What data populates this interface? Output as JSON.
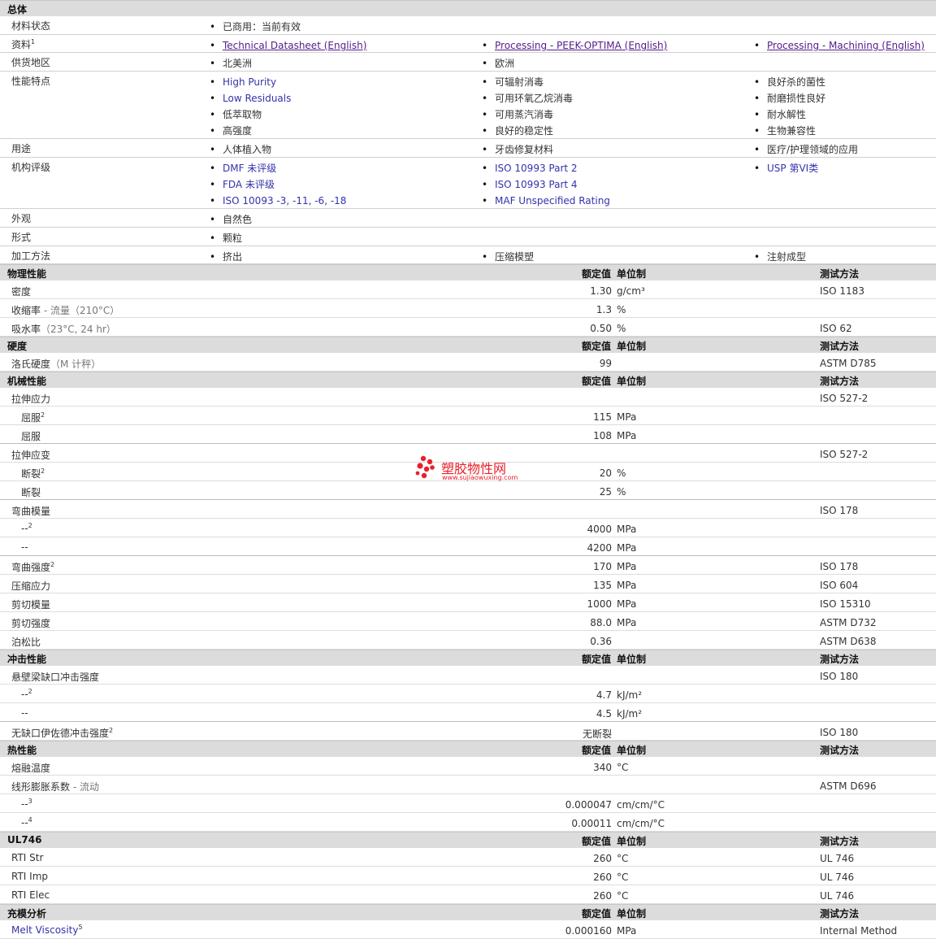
{
  "overview": {
    "title": "总体",
    "rows": [
      {
        "label": "材料状态",
        "cols": [
          [
            {
              "text": "已商用：当前有效"
            }
          ],
          [],
          []
        ]
      },
      {
        "label": "资料",
        "sup": "1",
        "cols": [
          [
            {
              "text": "Technical Datasheet (English)",
              "link": true
            }
          ],
          [
            {
              "text": "Processing - PEEK-OPTIMA (English)",
              "link": true
            }
          ],
          [
            {
              "text": "Processing - Machining (English)",
              "link": true
            }
          ]
        ]
      },
      {
        "label": "供货地区",
        "cols": [
          [
            {
              "text": "北美洲"
            }
          ],
          [
            {
              "text": "欧洲"
            }
          ],
          []
        ]
      },
      {
        "label": "性能特点",
        "cols": [
          [
            {
              "text": "High Purity",
              "blue": true
            },
            {
              "text": "Low Residuals",
              "blue": true
            },
            {
              "text": "低萃取物"
            },
            {
              "text": "高强度"
            }
          ],
          [
            {
              "text": "可辐射消毒"
            },
            {
              "text": "可用环氧乙烷消毒"
            },
            {
              "text": "可用蒸汽消毒"
            },
            {
              "text": "良好的稳定性"
            }
          ],
          [
            {
              "text": "良好杀的菌性"
            },
            {
              "text": "耐磨损性良好"
            },
            {
              "text": "耐水解性"
            },
            {
              "text": "生物兼容性"
            }
          ]
        ]
      },
      {
        "label": "用途",
        "cols": [
          [
            {
              "text": "人体植入物"
            }
          ],
          [
            {
              "text": "牙齿修复材料"
            }
          ],
          [
            {
              "text": "医疗/护理领域的应用"
            }
          ]
        ]
      },
      {
        "label": "机构评级",
        "cols": [
          [
            {
              "text": "DMF 未评级",
              "blue": true
            },
            {
              "text": "FDA 未评级",
              "blue": true
            },
            {
              "text": "ISO 10093 -3, -11, -6, -18",
              "blue": true
            }
          ],
          [
            {
              "text": "ISO 10993 Part 2",
              "blue": true
            },
            {
              "text": "ISO 10993 Part 4",
              "blue": true
            },
            {
              "text": "MAF Unspecified Rating",
              "blue": true
            }
          ],
          [
            {
              "text": "USP 第VI类",
              "blue": true
            }
          ]
        ]
      },
      {
        "label": "外观",
        "cols": [
          [
            {
              "text": "自然色"
            }
          ],
          [],
          []
        ]
      },
      {
        "label": "形式",
        "cols": [
          [
            {
              "text": "颗粒"
            }
          ],
          [],
          []
        ]
      },
      {
        "label": "加工方法",
        "cols": [
          [
            {
              "text": "挤出"
            }
          ],
          [
            {
              "text": "压缩模塑"
            }
          ],
          [
            {
              "text": "注射成型"
            }
          ]
        ]
      }
    ]
  },
  "headers": {
    "value": "额定值",
    "unit": "单位制",
    "method": "测试方法"
  },
  "sections": [
    {
      "title": "物理性能",
      "rows": [
        {
          "label": "密度",
          "value": "1.30",
          "unit": "g/cm³",
          "method": "ISO 1183"
        },
        {
          "label": "收缩率",
          "note": " - 流量（210°C）",
          "value": "1.3",
          "unit": "%",
          "method": ""
        },
        {
          "label": "吸水率",
          "note": "（23°C, 24 hr）",
          "value": "0.50",
          "unit": "%",
          "method": "ISO 62"
        }
      ]
    },
    {
      "title": "硬度",
      "rows": [
        {
          "label": "洛氏硬度",
          "note": "（M 计秤）",
          "value": "99",
          "unit": "",
          "method": "ASTM D785"
        }
      ]
    },
    {
      "title": "机械性能",
      "rows": [
        {
          "label": "拉伸应力",
          "value": "",
          "unit": "",
          "method": "ISO 527-2"
        },
        {
          "label": "屈服",
          "sub": true,
          "sup": "2",
          "value": "115",
          "unit": "MPa",
          "method": ""
        },
        {
          "label": "屈服",
          "sub": true,
          "value": "108",
          "unit": "MPa",
          "method": "",
          "end": true
        },
        {
          "label": "拉伸应变",
          "value": "",
          "unit": "",
          "method": "ISO 527-2"
        },
        {
          "label": "断裂",
          "sub": true,
          "sup": "2",
          "value": "20",
          "unit": "%",
          "method": ""
        },
        {
          "label": "断裂",
          "sub": true,
          "value": "25",
          "unit": "%",
          "method": "",
          "end": true
        },
        {
          "label": "弯曲模量",
          "value": "",
          "unit": "",
          "method": "ISO 178"
        },
        {
          "label": "--",
          "sub": true,
          "sup": "2",
          "value": "4000",
          "unit": "MPa",
          "method": ""
        },
        {
          "label": "--",
          "sub": true,
          "value": "4200",
          "unit": "MPa",
          "method": "",
          "end": true
        },
        {
          "label": "弯曲强度",
          "sup": "2",
          "value": "170",
          "unit": "MPa",
          "method": "ISO 178"
        },
        {
          "label": "压缩应力",
          "value": "135",
          "unit": "MPa",
          "method": "ISO 604"
        },
        {
          "label": "剪切模量",
          "value": "1000",
          "unit": "MPa",
          "method": "ISO 15310"
        },
        {
          "label": "剪切强度",
          "value": "88.0",
          "unit": "MPa",
          "method": "ASTM D732"
        },
        {
          "label": "泊松比",
          "value": "0.36",
          "unit": "",
          "method": "ASTM D638"
        }
      ]
    },
    {
      "title": "冲击性能",
      "rows": [
        {
          "label": "悬壁梁缺口冲击强度",
          "value": "",
          "unit": "",
          "method": "ISO 180"
        },
        {
          "label": "--",
          "sub": true,
          "sup": "2",
          "value": "4.7",
          "unit": "kJ/m²",
          "method": ""
        },
        {
          "label": "--",
          "sub": true,
          "value": "4.5",
          "unit": "kJ/m²",
          "method": "",
          "end": true
        },
        {
          "label": "无缺口伊佐德冲击强度",
          "sup": "2",
          "value": "无断裂",
          "unit": "",
          "method": "ISO 180"
        }
      ]
    },
    {
      "title": "热性能",
      "rows": [
        {
          "label": "熔融温度",
          "value": "340",
          "unit": "°C",
          "method": ""
        },
        {
          "label": "线形膨胀系数",
          "note": " - 流动",
          "value": "",
          "unit": "",
          "method": "ASTM D696"
        },
        {
          "label": "--",
          "sub": true,
          "sup": "3",
          "value": "0.000047",
          "unit": "cm/cm/°C",
          "method": ""
        },
        {
          "label": "--",
          "sub": true,
          "sup": "4",
          "value": "0.00011",
          "unit": "cm/cm/°C",
          "method": ""
        }
      ]
    },
    {
      "title": "UL746",
      "rows": [
        {
          "label": "RTI Str",
          "value": "260",
          "unit": "°C",
          "method": "UL 746"
        },
        {
          "label": "RTI Imp",
          "value": "260",
          "unit": "°C",
          "method": "UL 746"
        },
        {
          "label": "RTI Elec",
          "value": "260",
          "unit": "°C",
          "method": "UL 746"
        }
      ]
    },
    {
      "title": "充模分析",
      "rows": [
        {
          "label": "Melt Viscosity",
          "sup": "5",
          "blue": true,
          "value": "0.000160",
          "unit": "MPa",
          "method": "Internal Method"
        }
      ]
    }
  ],
  "watermark": {
    "name": "塑胶物性网",
    "url": "www.sujiaowuxing.com",
    "color": "#e8202a"
  }
}
